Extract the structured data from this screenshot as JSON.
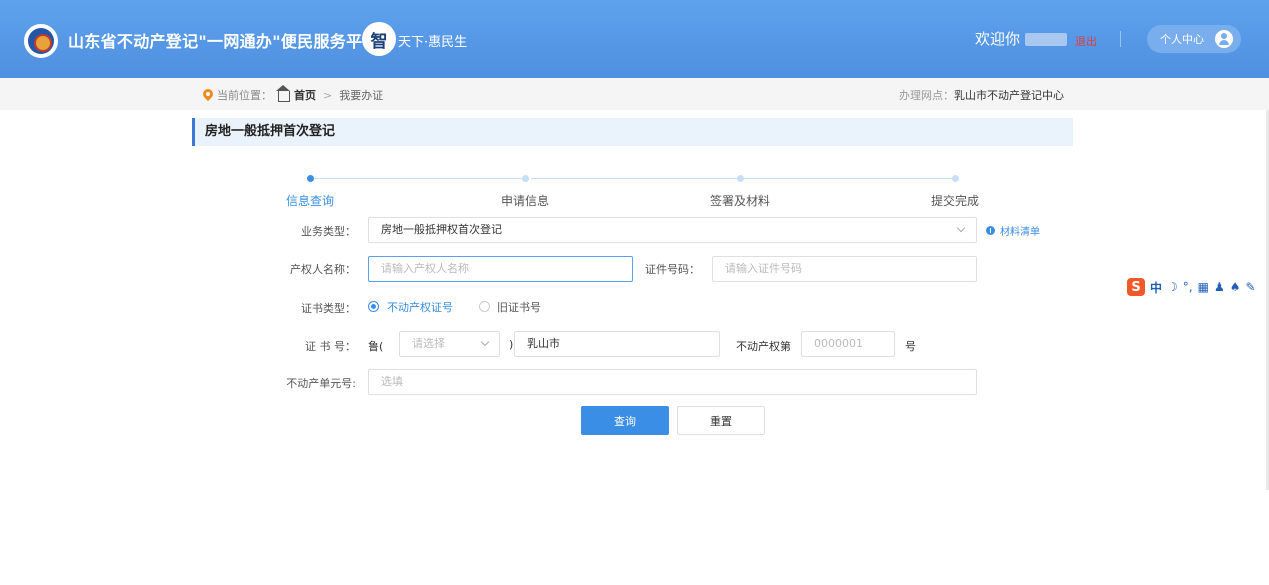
{
  "header": {
    "site_title": "山东省不动产登记\"一网通办\"便民服务平台",
    "slogan_mark": "智",
    "slogan_rest": "天下·惠民生",
    "welcome": "欢迎你",
    "logout": "退出",
    "personal_center": "个人中心"
  },
  "breadcrumb": {
    "prefix": "当前位置：",
    "home": "首页",
    "separator": ">",
    "current": "我要办证",
    "office_label": "办理网点：",
    "office_value": "乳山市不动产登记中心"
  },
  "section_title": "房地一般抵押首次登记",
  "steps": [
    {
      "label": "信息查询",
      "active": true
    },
    {
      "label": "申请信息",
      "active": false
    },
    {
      "label": "签署及材料",
      "active": false
    },
    {
      "label": "提交完成",
      "active": false
    }
  ],
  "form": {
    "business_type_label": "业务类型：",
    "business_type_value": "房地一般抵押权首次登记",
    "material_list": "材料清单",
    "owner_name_label": "产权人名称：",
    "owner_name_placeholder": "请输入产权人名称",
    "id_number_label": "证件号码：",
    "id_number_placeholder": "请输入证件号码",
    "cert_type_label": "证书类型：",
    "cert_type_options": [
      "不动产权证号",
      "旧证书号"
    ],
    "cert_type_selected": "不动产权证号",
    "cert_no_label": "证 书 号：",
    "cert_no_prefix": "鲁(",
    "year_placeholder": "请选择",
    "close_paren": ")",
    "city_value": "乳山市",
    "property_right_label": "不动产权第",
    "serial_placeholder": "0000001",
    "hao": "号",
    "unit_no_label": "不动产单元号:",
    "unit_no_placeholder": "选填"
  },
  "buttons": {
    "query": "查询",
    "reset": "重置"
  },
  "ime_toolbar": {
    "logo": "S",
    "mode": "中"
  },
  "colors": {
    "header": "#4f8fe0",
    "accent": "#3a8ee6",
    "logout": "#e03c3c",
    "section_bg": "#eaf2fb"
  }
}
